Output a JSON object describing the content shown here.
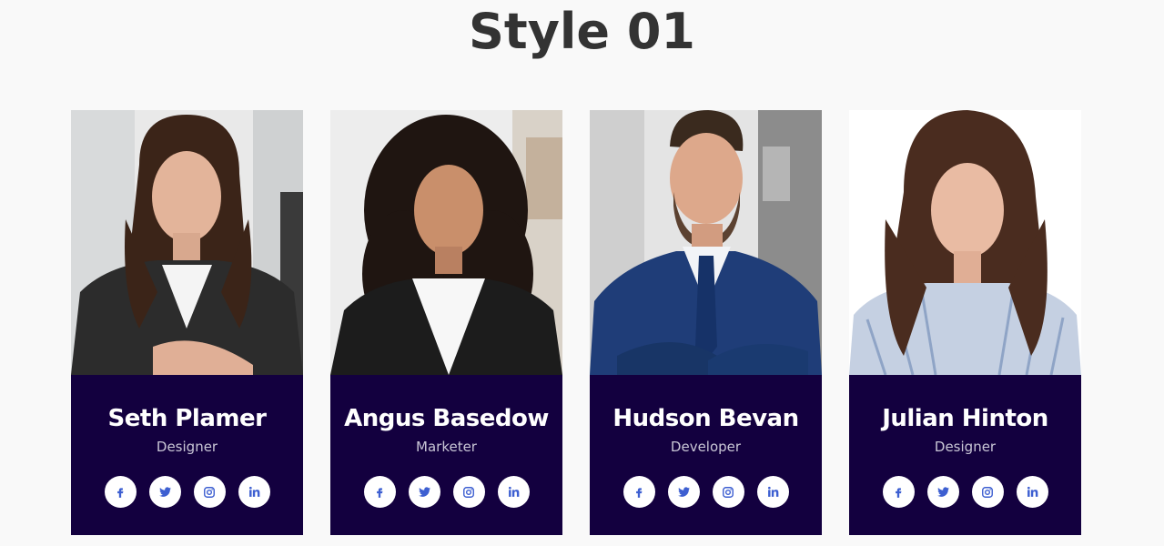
{
  "header": {
    "title": "Style 01"
  },
  "colors": {
    "background": "#f9f9f9",
    "card_info_bg": "#13003f",
    "name_text": "#ffffff",
    "role_text": "#c9c6d6",
    "social_bg": "#ffffff",
    "social_icon": "#3d5fd1",
    "title_text": "#333333"
  },
  "team": [
    {
      "name": "Seth Plamer",
      "role": "Designer",
      "photo": "portrait-woman-dark-hair-black-blazer",
      "socials": [
        "facebook-icon",
        "twitter-icon",
        "instagram-icon",
        "linkedin-icon"
      ]
    },
    {
      "name": "Angus Basedow",
      "role": "Marketer",
      "photo": "portrait-woman-curly-hair-black-blazer",
      "socials": [
        "facebook-icon",
        "twitter-icon",
        "instagram-icon",
        "linkedin-icon"
      ]
    },
    {
      "name": "Hudson Bevan",
      "role": "Developer",
      "photo": "portrait-man-navy-suit",
      "socials": [
        "facebook-icon",
        "twitter-icon",
        "instagram-icon",
        "linkedin-icon"
      ]
    },
    {
      "name": "Julian Hinton",
      "role": "Designer",
      "photo": "portrait-woman-long-hair-striped-shirt",
      "socials": [
        "facebook-icon",
        "twitter-icon",
        "instagram-icon",
        "linkedin-icon"
      ]
    }
  ]
}
